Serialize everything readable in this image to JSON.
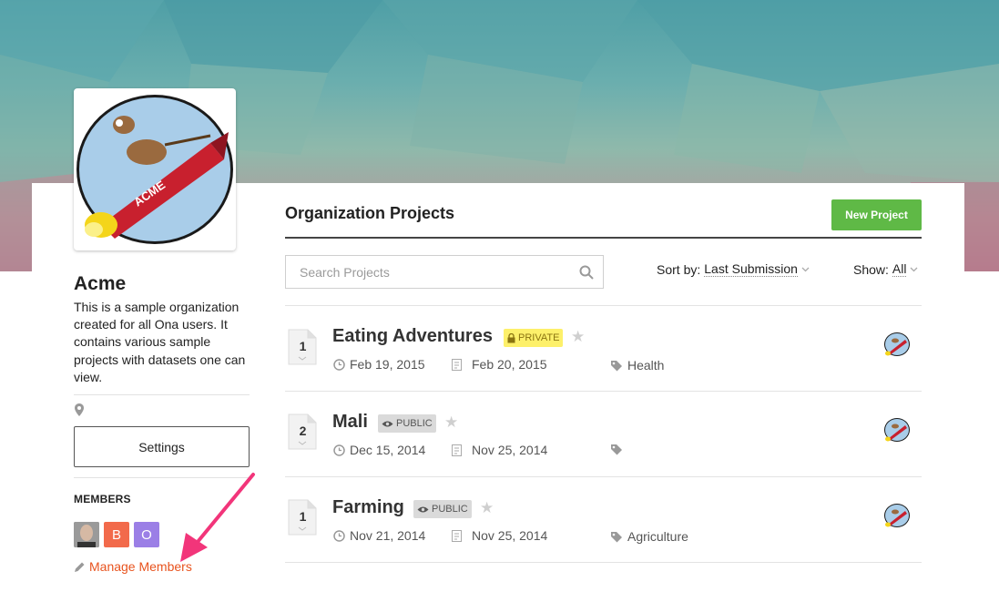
{
  "organization": {
    "name": "Acme",
    "description": "This is a sample organization created for all Ona users. It contains various sample projects with datasets one can view.",
    "settings_label": "Settings",
    "members_heading": "MEMBERS",
    "members": [
      {
        "initial": "",
        "color": "#8a8a8a",
        "type": "photo"
      },
      {
        "initial": "B",
        "color": "#f26a4b",
        "type": "letter"
      },
      {
        "initial": "O",
        "color": "#9b7fe6",
        "type": "letter"
      }
    ],
    "manage_members_label": "Manage Members"
  },
  "projects_panel": {
    "title": "Organization Projects",
    "new_project_label": "New Project",
    "search_placeholder": "Search Projects",
    "sort_label": "Sort by:",
    "sort_value": "Last Submission",
    "show_label": "Show:",
    "show_value": "All"
  },
  "projects": [
    {
      "forms": "1",
      "name": "Eating Adventures",
      "visibility": "PRIVATE",
      "created": "Feb 19, 2015",
      "last_submission": "Feb 20, 2015",
      "tag": "Health"
    },
    {
      "forms": "2",
      "name": "Mali",
      "visibility": "PUBLIC",
      "created": "Dec 15, 2014",
      "last_submission": "Nov 25, 2014",
      "tag": ""
    },
    {
      "forms": "1",
      "name": "Farming",
      "visibility": "PUBLIC",
      "created": "Nov 21, 2014",
      "last_submission": "Nov 25, 2014",
      "tag": "Agriculture"
    }
  ],
  "icons": {
    "search": "search-icon",
    "pin": "map-pin-icon",
    "pencil": "pencil-icon",
    "lock": "lock-icon",
    "eye": "eye-icon",
    "star": "star-icon",
    "clock": "clock-icon",
    "submission": "document-icon",
    "tag": "tag-icon"
  },
  "colors": {
    "accent": "#e8531e",
    "new_button": "#5fb946",
    "private_badge": "#fdf06a",
    "public_badge": "#dadada",
    "arrow": "#f2357a"
  }
}
